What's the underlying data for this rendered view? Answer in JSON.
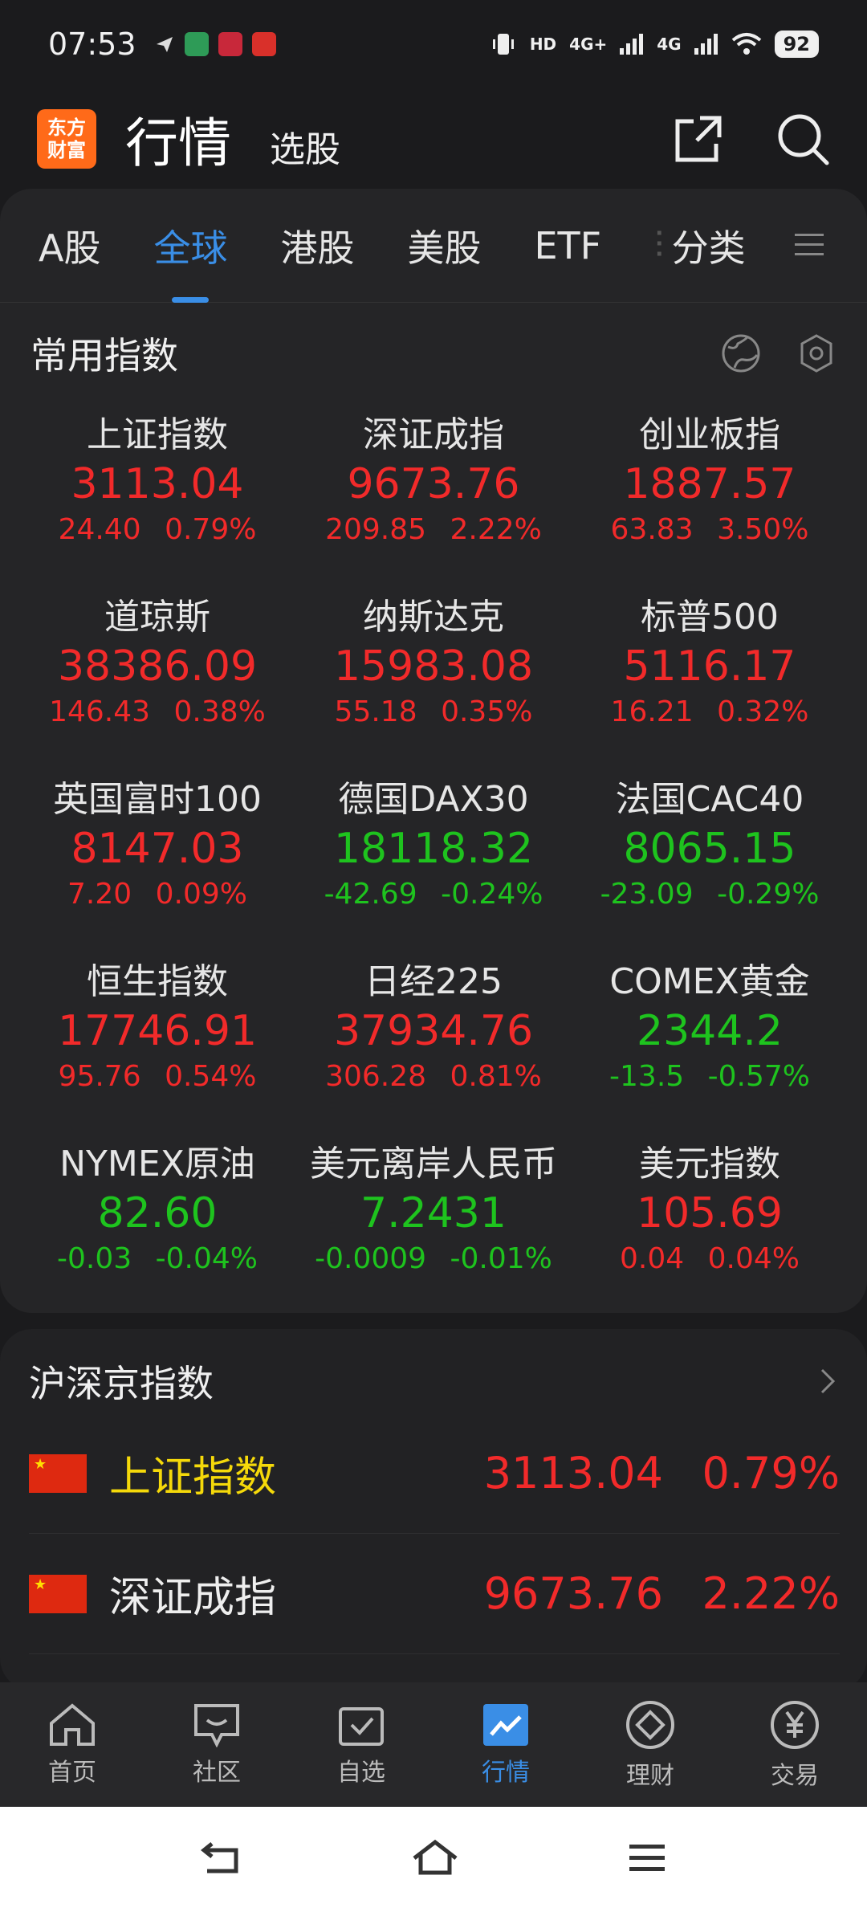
{
  "status": {
    "time": "07:53",
    "net1": "HD",
    "net2": "4G+",
    "net3": "4G",
    "battery": "92"
  },
  "header": {
    "logo_line1": "东方",
    "logo_line2": "财富",
    "title": "行情",
    "subtitle": "选股"
  },
  "tabs": [
    {
      "label": "A股"
    },
    {
      "label": "全球"
    },
    {
      "label": "港股"
    },
    {
      "label": "美股"
    },
    {
      "label": "ETF"
    },
    {
      "label": "分类"
    }
  ],
  "common_indices": {
    "title": "常用指数",
    "items": [
      {
        "name": "上证指数",
        "price": "3113.04",
        "change": "24.40",
        "pct": "0.79%",
        "dir": "up"
      },
      {
        "name": "深证成指",
        "price": "9673.76",
        "change": "209.85",
        "pct": "2.22%",
        "dir": "up"
      },
      {
        "name": "创业板指",
        "price": "1887.57",
        "change": "63.83",
        "pct": "3.50%",
        "dir": "up"
      },
      {
        "name": "道琼斯",
        "price": "38386.09",
        "change": "146.43",
        "pct": "0.38%",
        "dir": "up"
      },
      {
        "name": "纳斯达克",
        "price": "15983.08",
        "change": "55.18",
        "pct": "0.35%",
        "dir": "up"
      },
      {
        "name": "标普500",
        "price": "5116.17",
        "change": "16.21",
        "pct": "0.32%",
        "dir": "up"
      },
      {
        "name": "英国富时100",
        "price": "8147.03",
        "change": "7.20",
        "pct": "0.09%",
        "dir": "up"
      },
      {
        "name": "德国DAX30",
        "price": "18118.32",
        "change": "-42.69",
        "pct": "-0.24%",
        "dir": "down"
      },
      {
        "name": "法国CAC40",
        "price": "8065.15",
        "change": "-23.09",
        "pct": "-0.29%",
        "dir": "down"
      },
      {
        "name": "恒生指数",
        "price": "17746.91",
        "change": "95.76",
        "pct": "0.54%",
        "dir": "up"
      },
      {
        "name": "日经225",
        "price": "37934.76",
        "change": "306.28",
        "pct": "0.81%",
        "dir": "up"
      },
      {
        "name": "COMEX黄金",
        "price": "2344.2",
        "change": "-13.5",
        "pct": "-0.57%",
        "dir": "down"
      },
      {
        "name": "NYMEX原油",
        "price": "82.60",
        "change": "-0.03",
        "pct": "-0.04%",
        "dir": "down"
      },
      {
        "name": "美元离岸人民币",
        "price": "7.2431",
        "change": "-0.0009",
        "pct": "-0.01%",
        "dir": "down"
      },
      {
        "name": "美元指数",
        "price": "105.69",
        "change": "0.04",
        "pct": "0.04%",
        "dir": "up"
      }
    ]
  },
  "hsj": {
    "title": "沪深京指数",
    "rows": [
      {
        "name": "上证指数",
        "price": "3113.04",
        "pct": "0.79%"
      },
      {
        "name": "深证成指",
        "price": "9673.76",
        "pct": "2.22%"
      }
    ]
  },
  "nav": [
    {
      "label": "首页",
      "icon": "home-icon"
    },
    {
      "label": "社区",
      "icon": "chat-icon"
    },
    {
      "label": "自选",
      "icon": "watchlist-icon"
    },
    {
      "label": "行情",
      "icon": "market-icon"
    },
    {
      "label": "理财",
      "icon": "wealth-icon"
    },
    {
      "label": "交易",
      "icon": "yen-icon"
    }
  ],
  "colors": {
    "up": "#f22a2a",
    "down": "#1ec31e",
    "accent": "#3a8ee6",
    "brand": "#ff6a19"
  }
}
